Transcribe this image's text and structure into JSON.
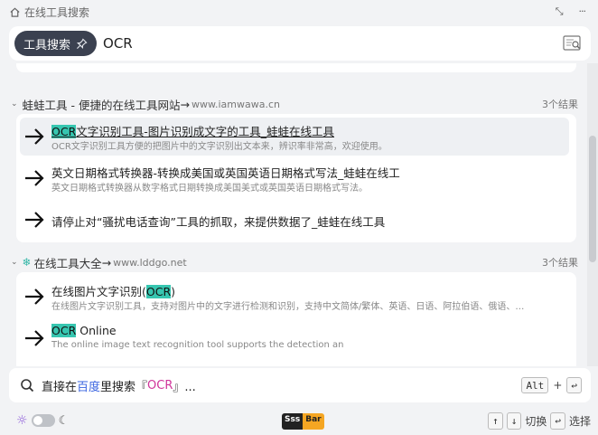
{
  "topbar": {
    "title": "在线工具搜索",
    "collapse_label": "⤡",
    "menu_label": "···"
  },
  "search": {
    "tool_pill": "工具搜索",
    "query": "OCR"
  },
  "groups": [
    {
      "name": "蛙蛙工具 - 便捷的在线工具网站",
      "arrow": "→",
      "site": "www.iamwawa.cn",
      "count": "3个结果",
      "items": [
        {
          "title_hl": "OCR",
          "title_rest": "文字识别工具-图片识别成文字的工具_蛙蛙在线工具",
          "desc": "OCR文字识别工具方便的把图片中的文字识别出文本来，辨识率非常高，欢迎使用。"
        },
        {
          "title": "英文日期格式转换器-转换成美国或英国英语日期格式写法_蛙蛙在线工",
          "desc": "英文日期格式转换器从数字格式日期转换成美国美式或英国英语日期格式写法。"
        },
        {
          "title": "请停止对“骚扰电话查询”工具的抓取，来提供数据了_蛙蛙在线工具"
        }
      ]
    },
    {
      "name": "在线工具大全",
      "arrow": "→",
      "site": "www.lddgo.net",
      "count": "3个结果",
      "items": [
        {
          "title_pre": "在线图片文字识别(",
          "title_hl": "OCR",
          "title_post": ")",
          "desc": "在线图片文字识别工具，支持对图片中的文字进行检测和识别，支持中文简体/繁体、英语、日语、阿拉伯语、俄语、…"
        },
        {
          "title_hl": "OCR",
          "title_rest": " Online",
          "desc": "The online image text recognition tool supports the detection an"
        }
      ]
    }
  ],
  "web_search": {
    "prefix": "直接在",
    "engine": "百度",
    "middle": "里搜索『",
    "keyword": "OCR",
    "suffix": "』...",
    "key1": "Alt",
    "plus": "+",
    "key2": "↩"
  },
  "footer": {
    "logo_a": "Sss",
    "logo_b": "Bar",
    "up": "↑",
    "down": "↓",
    "switch_label": "切换",
    "enter": "↩",
    "select_label": "选择"
  }
}
